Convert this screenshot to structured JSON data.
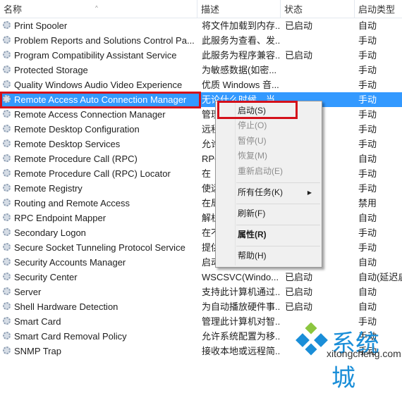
{
  "header": {
    "name": "名称",
    "description": "描述",
    "status": "状态",
    "startup": "启动类型"
  },
  "rows": [
    {
      "name": "Print Spooler",
      "desc": "将文件加载到内存...",
      "status": "已启动",
      "startup": "自动"
    },
    {
      "name": "Problem Reports and Solutions Control Pa...",
      "desc": "此服务为查看、发...",
      "status": "",
      "startup": "手动"
    },
    {
      "name": "Program Compatibility Assistant Service",
      "desc": "此服务为程序兼容...",
      "status": "已启动",
      "startup": "手动"
    },
    {
      "name": "Protected Storage",
      "desc": "为敏感数据(如密...",
      "status": "",
      "startup": "手动"
    },
    {
      "name": "Quality Windows Audio Video Experience",
      "desc": "优质 Windows 音...",
      "status": "",
      "startup": "手动"
    },
    {
      "name": "Remote Access Auto Connection Manager",
      "desc": "无论什么时候，当",
      "status": "",
      "startup": "手动"
    },
    {
      "name": "Remote Access Connection Manager",
      "desc": "管理",
      "status": "",
      "startup": "手动"
    },
    {
      "name": "Remote Desktop Configuration",
      "desc": "远程",
      "status": "",
      "startup": "手动"
    },
    {
      "name": "Remote Desktop Services",
      "desc": "允许",
      "status": "",
      "startup": "手动"
    },
    {
      "name": "Remote Procedure Call (RPC)",
      "desc": "RPC",
      "status": "",
      "startup": "自动"
    },
    {
      "name": "Remote Procedure Call (RPC) Locator",
      "desc": "在",
      "status": "",
      "startup": "手动"
    },
    {
      "name": "Remote Registry",
      "desc": "使远",
      "status": "",
      "startup": "手动"
    },
    {
      "name": "Routing and Remote Access",
      "desc": "在局",
      "status": "",
      "startup": "禁用"
    },
    {
      "name": "RPC Endpoint Mapper",
      "desc": "解析",
      "status": "",
      "startup": "自动"
    },
    {
      "name": "Secondary Logon",
      "desc": "在不",
      "status": "",
      "startup": "手动"
    },
    {
      "name": "Secure Socket Tunneling Protocol Service",
      "desc": "提供",
      "status": "",
      "startup": "手动"
    },
    {
      "name": "Security Accounts Manager",
      "desc": "启动",
      "status": "",
      "startup": "自动"
    },
    {
      "name": "Security Center",
      "desc": "WSCSVC(Windo...",
      "status": "已启动",
      "startup": "自动(延迟启"
    },
    {
      "name": "Server",
      "desc": "支持此计算机通过...",
      "status": "已启动",
      "startup": "自动"
    },
    {
      "name": "Shell Hardware Detection",
      "desc": "为自动播放硬件事...",
      "status": "已启动",
      "startup": "自动"
    },
    {
      "name": "Smart Card",
      "desc": "管理此计算机对智...",
      "status": "",
      "startup": "手动"
    },
    {
      "name": "Smart Card Removal Policy",
      "desc": "允许系统配置为移...",
      "status": "",
      "startup": "手动"
    },
    {
      "name": "SNMP Trap",
      "desc": "接收本地或远程简...",
      "status": "",
      "startup": "手动"
    }
  ],
  "selected_index": 5,
  "context_menu": {
    "start": "启动(S)",
    "stop": "停止(O)",
    "pause": "暂停(U)",
    "resume": "恢复(M)",
    "restart": "重新启动(E)",
    "all_tasks": "所有任务(K)",
    "refresh": "刷新(F)",
    "properties": "属性(R)",
    "help": "帮助(H)"
  },
  "watermark": {
    "text": "系统城",
    "url": "xitongcheng.com"
  },
  "colors": {
    "selection": "#3399ff",
    "highlight_box": "#d4101a"
  }
}
